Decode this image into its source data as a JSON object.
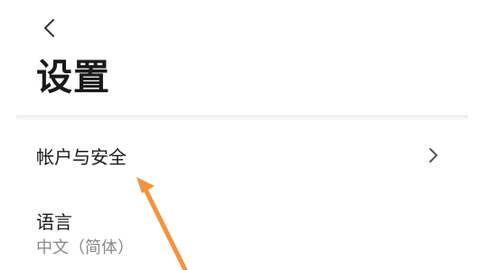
{
  "header": {
    "back_icon": "chevron-left-icon",
    "title": "设置"
  },
  "settings": {
    "account_security": {
      "label": "帐户与安全",
      "icon": "chevron-right-icon"
    },
    "language": {
      "label": "语言",
      "value": "中文（简体）"
    }
  },
  "annotation": {
    "color": "#F5923E"
  }
}
